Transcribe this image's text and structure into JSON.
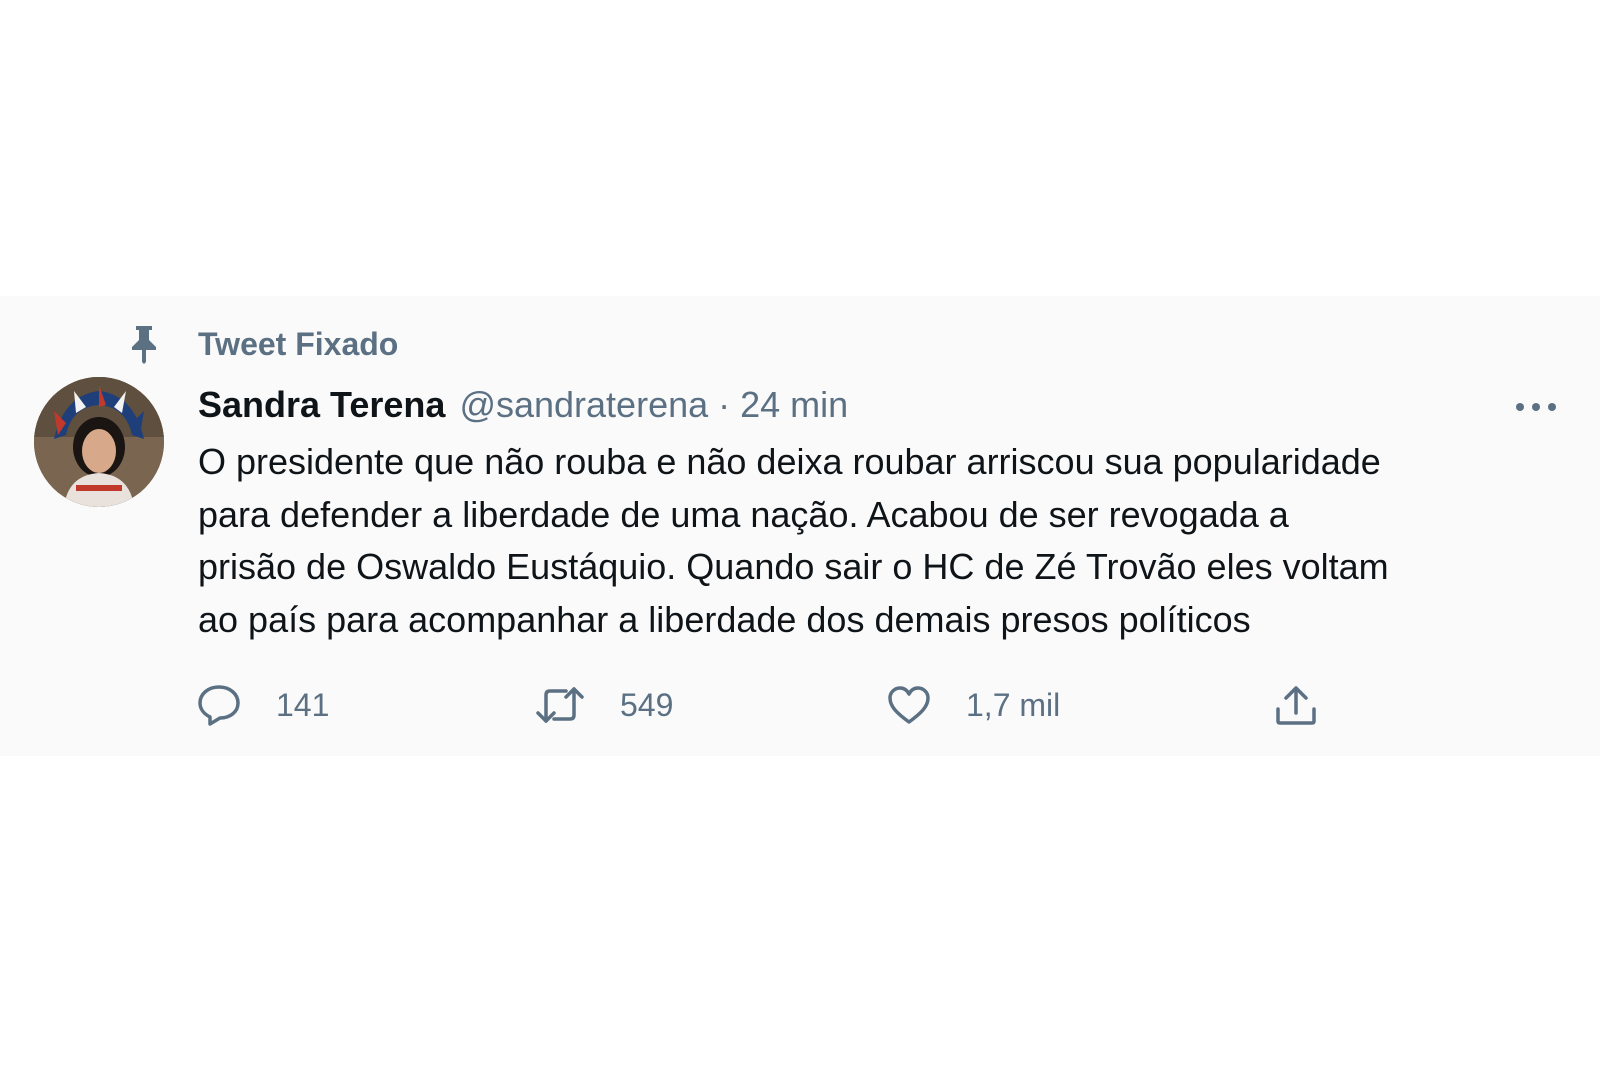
{
  "pinned": {
    "label": "Tweet Fixado",
    "icon": "pin-icon"
  },
  "author": {
    "display_name": "Sandra Terena",
    "handle": "@sandraterena",
    "separator": "·",
    "timestamp": "24 min",
    "avatar_icon": "avatar-photo"
  },
  "tweet": {
    "text_lines": [
      "O presidente que não rouba e não deixa roubar arriscou sua popularidade",
      "para defender a liberdade de uma nação. Acabou de ser revogada a",
      "prisão de Oswaldo Eustáquio. Quando sair o HC de Zé Trovão eles voltam",
      "ao país para acompanhar a liberdade dos demais presos políticos"
    ]
  },
  "actions": {
    "reply": {
      "icon": "reply-icon",
      "count": "141"
    },
    "retweet": {
      "icon": "retweet-icon",
      "count": "549"
    },
    "like": {
      "icon": "heart-icon",
      "count": "1,7 mil"
    },
    "share": {
      "icon": "share-icon"
    }
  },
  "more": {
    "icon": "more-icon"
  },
  "colors": {
    "text_primary": "#0f1419",
    "text_secondary": "#5b7083",
    "card_background": "#fafafa",
    "page_background": "#ffffff"
  }
}
